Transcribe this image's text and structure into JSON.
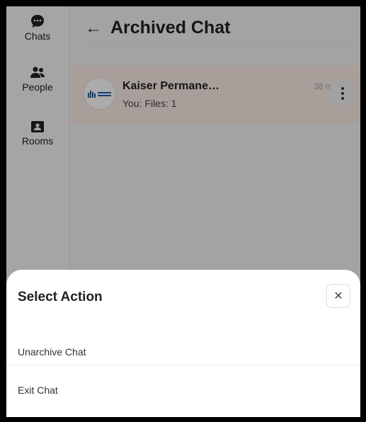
{
  "sidebar": {
    "items": [
      {
        "label": "Chats",
        "icon": "chat-bubble-icon"
      },
      {
        "label": "People",
        "icon": "people-icon"
      },
      {
        "label": "Rooms",
        "icon": "rooms-icon"
      }
    ]
  },
  "header": {
    "back_icon": "←",
    "title": "Archived Chat"
  },
  "chat": {
    "name": "Kaiser Permane…",
    "subtitle": "You: Files: 1",
    "time": "38 min",
    "avatar_icon": "kaiser-permanente-logo"
  },
  "sheet": {
    "title": "Select Action",
    "close_icon": "✕",
    "options": [
      {
        "label": "Unarchive Chat"
      },
      {
        "label": "Exit Chat"
      }
    ]
  },
  "colors": {
    "highlight_row": "#fbeee6",
    "overlay": "rgba(0,0,0,0.33)",
    "logo_blue": "#1a5fa8"
  }
}
